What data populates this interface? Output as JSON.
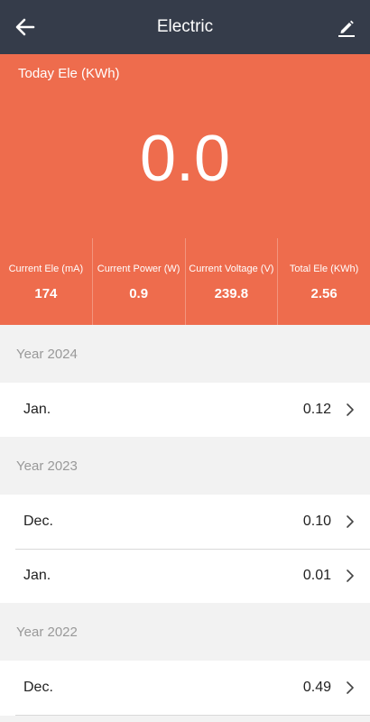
{
  "header": {
    "title": "Electric",
    "back_icon": "arrow-left-icon",
    "edit_icon": "pencil-icon"
  },
  "today": {
    "label": "Today Ele (KWh)",
    "value": "0.0"
  },
  "stats": [
    {
      "label": "Current Ele (mA)",
      "value": "174"
    },
    {
      "label": "Current Power (W)",
      "value": "0.9"
    },
    {
      "label": "Current Voltage (V)",
      "value": "239.8"
    },
    {
      "label": "Total Ele (KWh)",
      "value": "2.56"
    }
  ],
  "years": [
    {
      "label": "Year 2024",
      "months": [
        {
          "month": "Jan.",
          "value": "0.12"
        }
      ]
    },
    {
      "label": "Year 2023",
      "months": [
        {
          "month": "Dec.",
          "value": "0.10"
        },
        {
          "month": "Jan.",
          "value": "0.01"
        }
      ]
    },
    {
      "label": "Year 2022",
      "months": [
        {
          "month": "Dec.",
          "value": "0.49"
        }
      ]
    }
  ],
  "colors": {
    "header_bg": "#353c4a",
    "accent": "#ee6c4d",
    "page_bg": "#f2f2f2"
  }
}
